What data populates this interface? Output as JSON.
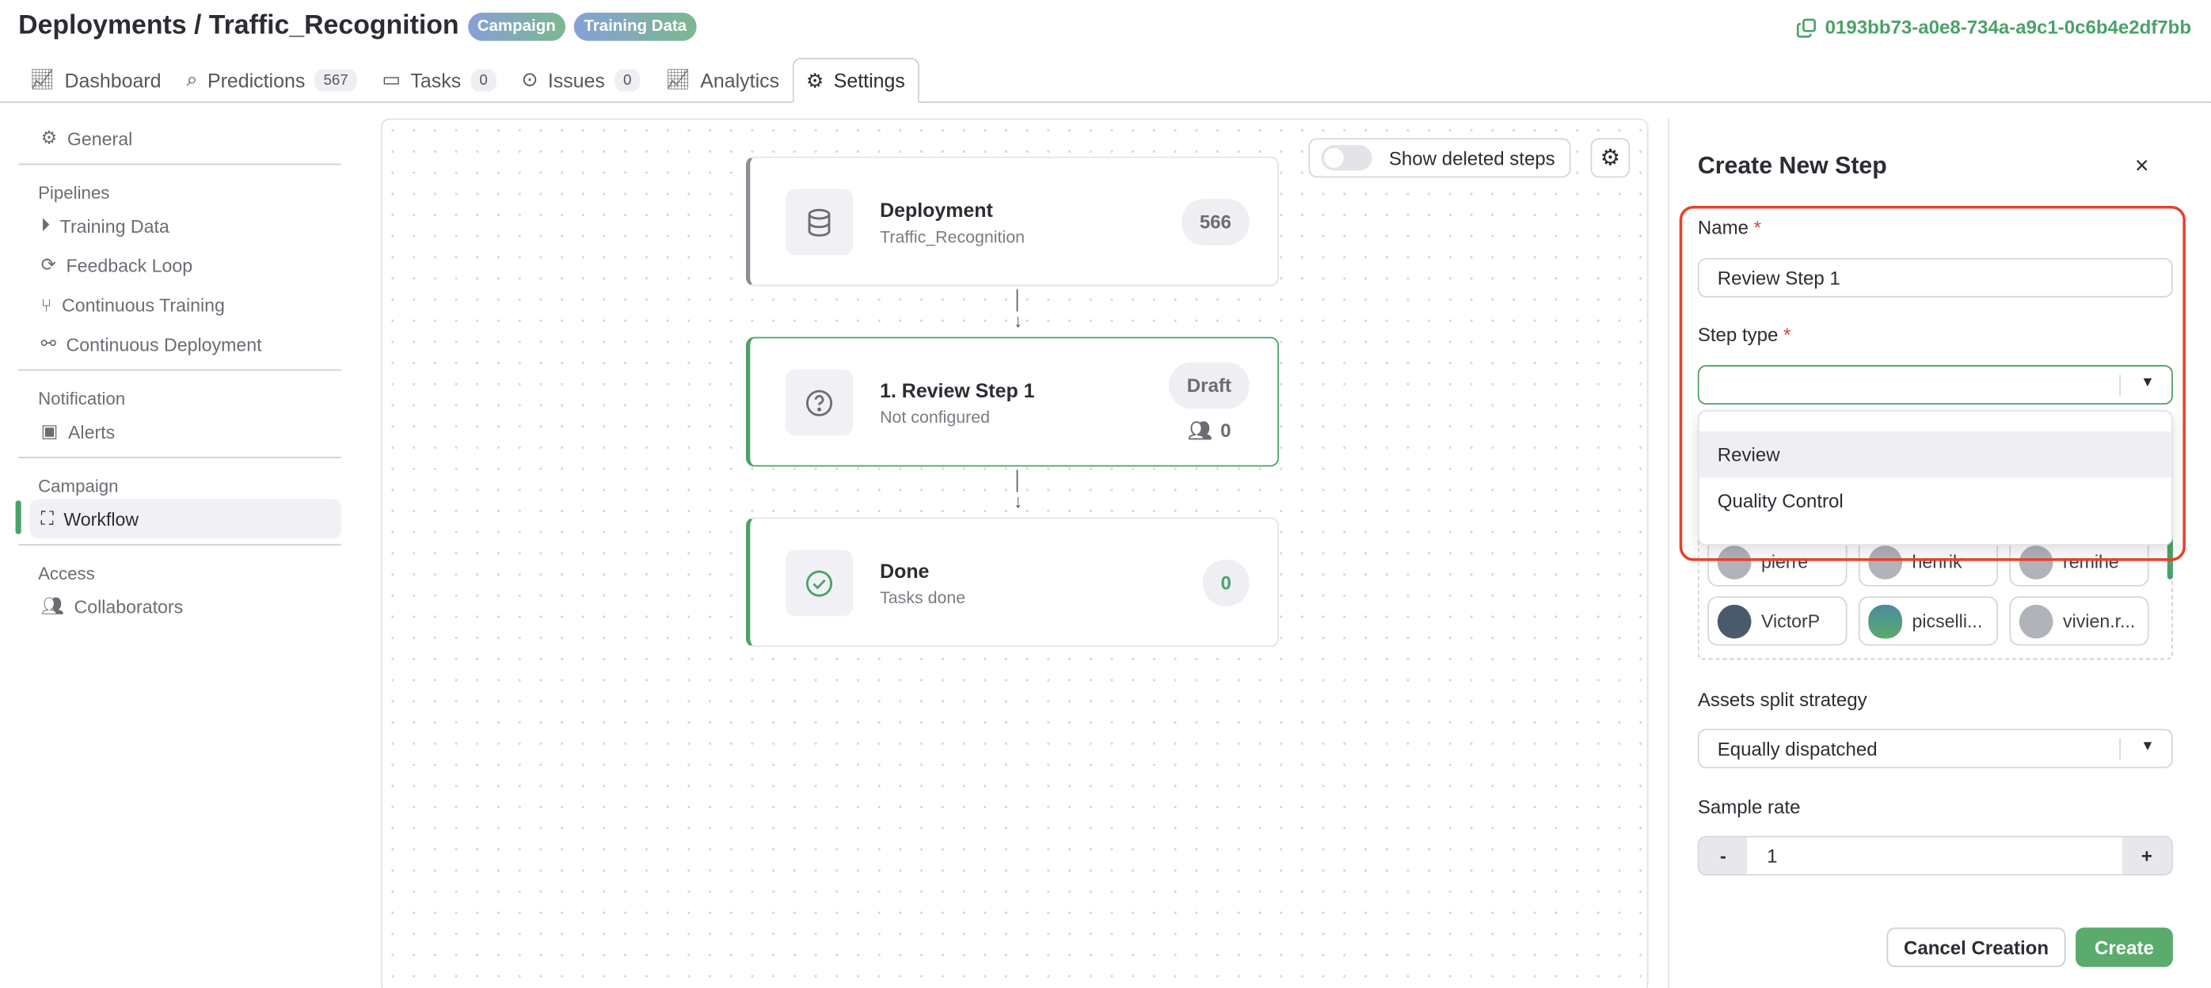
{
  "header": {
    "title": "Deployments / Traffic_Recognition",
    "badges": [
      "Campaign",
      "Training Data"
    ],
    "uuid": "0193bb73-a0e8-734a-a9c1-0c6b4e2df7bb"
  },
  "tabs": [
    {
      "label": "Dashboard",
      "icon": "chart-line-icon"
    },
    {
      "label": "Predictions",
      "count": "567",
      "icon": "search-icon"
    },
    {
      "label": "Tasks",
      "count": "0",
      "icon": "inbox-icon"
    },
    {
      "label": "Issues",
      "count": "0",
      "icon": "circle-dot-icon"
    },
    {
      "label": "Analytics",
      "icon": "chart-line-icon"
    },
    {
      "label": "Settings",
      "icon": "gear-icon",
      "active": true
    }
  ],
  "sidebar": {
    "general": "General",
    "pipelines": {
      "heading": "Pipelines",
      "items": [
        "Training Data",
        "Feedback Loop",
        "Continuous Training",
        "Continuous Deployment"
      ]
    },
    "notification": {
      "heading": "Notification",
      "items": [
        "Alerts"
      ]
    },
    "campaign": {
      "heading": "Campaign",
      "items": [
        "Workflow"
      ]
    },
    "access": {
      "heading": "Access",
      "items": [
        "Collaborators"
      ]
    }
  },
  "canvas": {
    "show_deleted": "Show deleted steps",
    "show_deleted_on": false,
    "cards": [
      {
        "title": "Deployment",
        "subtitle": "Traffic_Recognition",
        "count": "566"
      },
      {
        "title": "1. Review Step 1",
        "subtitle": "Not configured",
        "status": "Draft",
        "assignees": "0"
      },
      {
        "title": "Done",
        "subtitle": "Tasks done",
        "count": "0"
      }
    ]
  },
  "panel": {
    "title": "Create New Step",
    "name_label": "Name",
    "name_value": "Review Step 1",
    "step_type_label": "Step type",
    "step_type_value": "",
    "options": [
      "Review",
      "Quality Control"
    ],
    "users": [
      "pierre",
      "henrik",
      "remihe",
      "VictorP",
      "picselli...",
      "vivien.r..."
    ],
    "split_label": "Assets split strategy",
    "split_value": "Equally dispatched",
    "sample_label": "Sample rate",
    "sample_value": "1",
    "minus": "-",
    "plus": "+",
    "cancel": "Cancel Creation",
    "create": "Create"
  },
  "colors": {
    "accent": "#4aa268",
    "highlight": "#e8412c"
  }
}
